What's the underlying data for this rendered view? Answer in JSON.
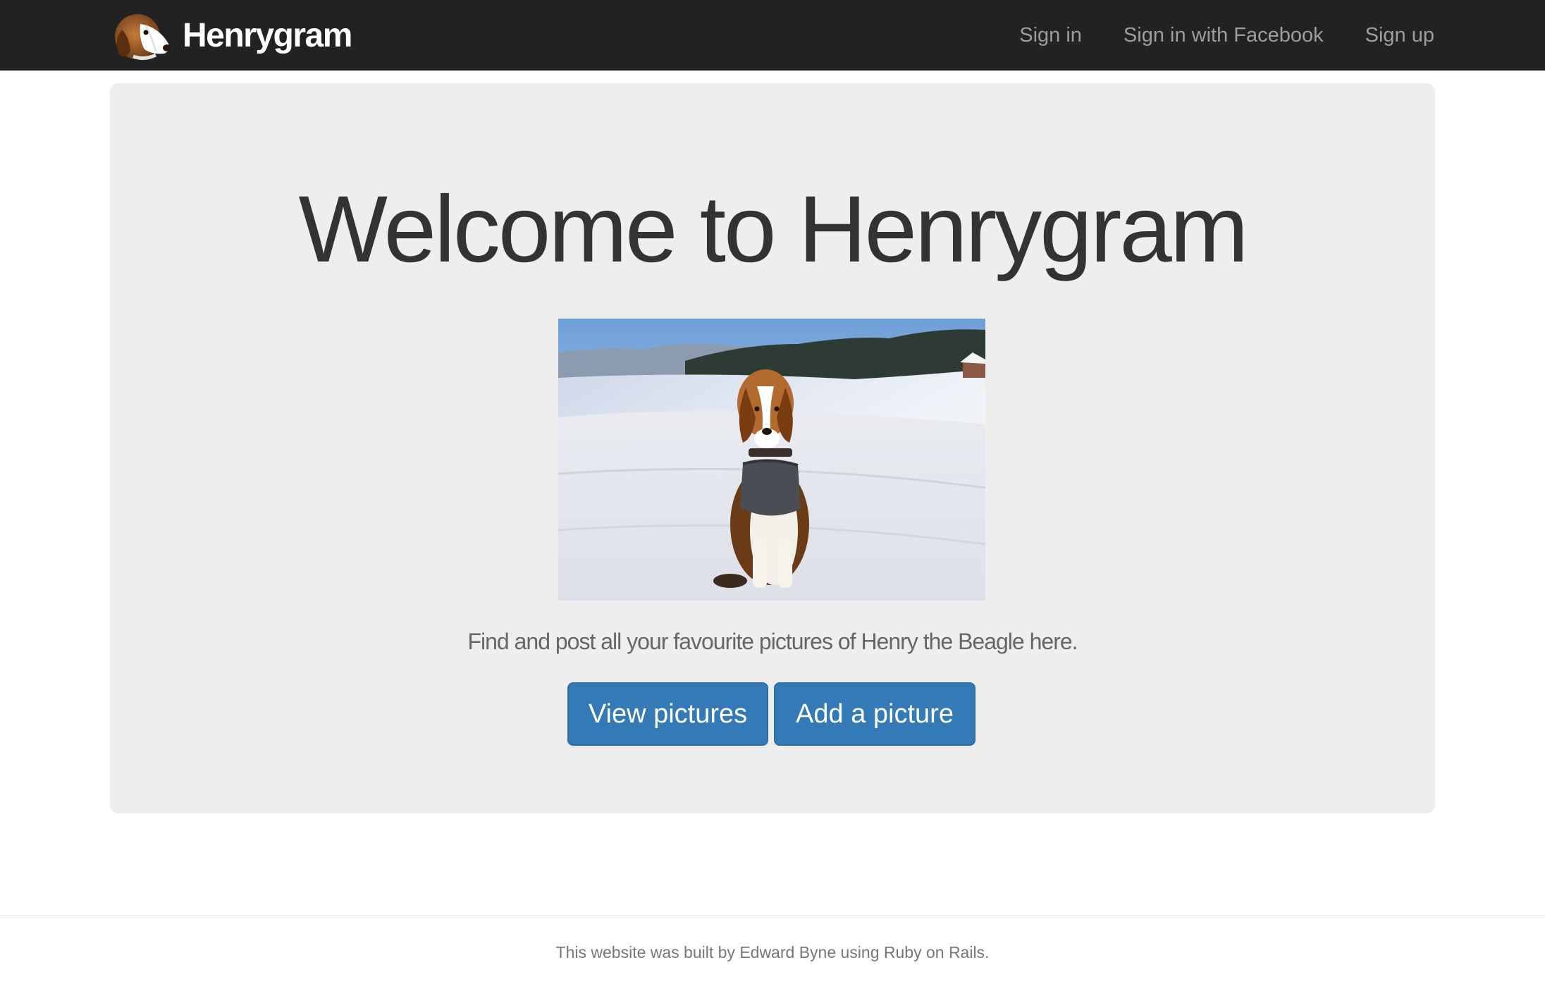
{
  "navbar": {
    "brand": "Henrygram",
    "logo_icon": "beagle-head-logo",
    "links": [
      "Sign in",
      "Sign in with Facebook",
      "Sign up"
    ]
  },
  "hero": {
    "title": "Welcome to Henrygram",
    "image_icon": "beagle-in-snow-photo",
    "tagline": "Find and post all your favourite pictures of Henry the Beagle here.",
    "buttons": {
      "view": "View pictures",
      "add": "Add a picture"
    }
  },
  "footer": {
    "text": "This website was built by Edward Byne using Ruby on Rails."
  },
  "colors": {
    "navbar_bg": "#222222",
    "jumbotron_bg": "#eeeeee",
    "primary_button": "#337ab7"
  }
}
